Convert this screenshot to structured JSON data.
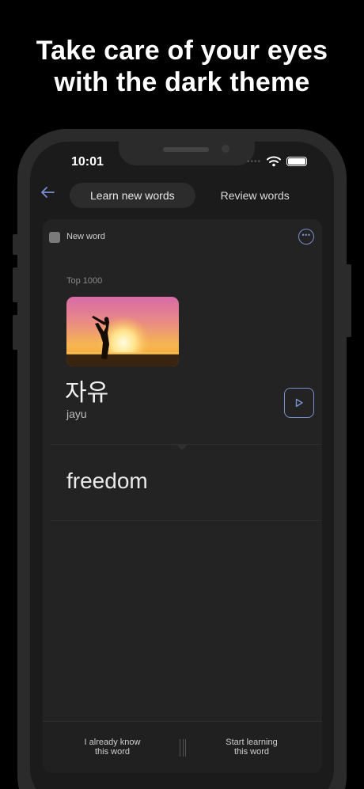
{
  "headline": {
    "line1": "Take care of your eyes",
    "line2": "with the dark theme"
  },
  "status_bar": {
    "time": "10:01"
  },
  "tabs": [
    {
      "label": "Learn new words",
      "active": true
    },
    {
      "label": "Review words",
      "active": false
    }
  ],
  "card": {
    "status_label": "New word",
    "tag": "Top 1000",
    "word": "자유",
    "romanization": "jayu",
    "translation": "freedom"
  },
  "actions": {
    "known_line1": "I already know",
    "known_line2": "this word",
    "learn_line1": "Start learning",
    "learn_line2": "this word"
  },
  "icons": [
    "back-arrow-icon",
    "more-options-icon",
    "play-audio-icon",
    "wifi-icon",
    "battery-icon",
    "signal-dots-icon"
  ],
  "colors": {
    "accent": "#7b90cf",
    "background": "#000000",
    "screen": "#1b1b1b",
    "card": "#232323"
  }
}
